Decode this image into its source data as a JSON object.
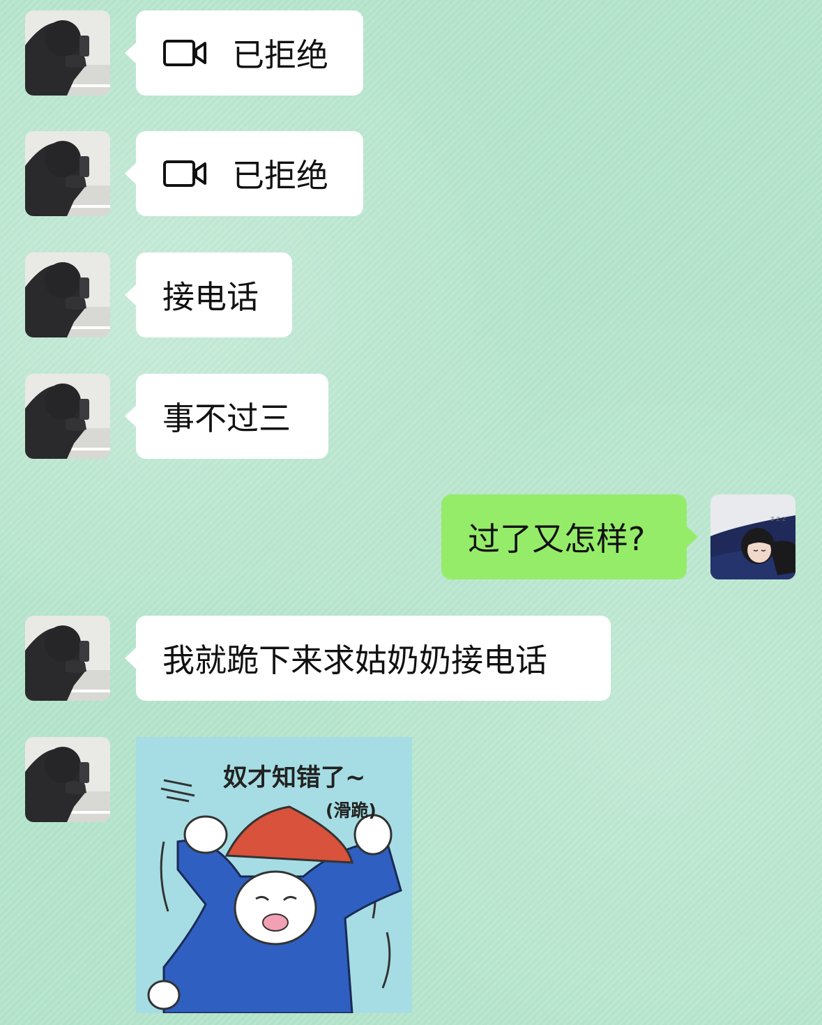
{
  "messages": [
    {
      "side": "left",
      "type": "video_call",
      "text": "已拒绝"
    },
    {
      "side": "left",
      "type": "video_call",
      "text": "已拒绝"
    },
    {
      "side": "left",
      "type": "text",
      "text": "接电话"
    },
    {
      "side": "left",
      "type": "text",
      "text": "事不过三"
    },
    {
      "side": "right",
      "type": "text",
      "text": "过了又怎样?"
    },
    {
      "side": "left",
      "type": "text",
      "text": "我就跪下来求姑奶奶接电话"
    },
    {
      "side": "left",
      "type": "sticker",
      "caption_main": "奴才知错了~",
      "caption_sub": "(滑跪)"
    }
  ],
  "colors": {
    "background": "#b5e5cc",
    "incoming_bubble": "#ffffff",
    "outgoing_bubble": "#95ec69"
  },
  "icons": {
    "video_call": "video-camera-icon",
    "contact_avatar": "hooded-person-avatar",
    "self_avatar": "sleeping-girl-avatar"
  }
}
